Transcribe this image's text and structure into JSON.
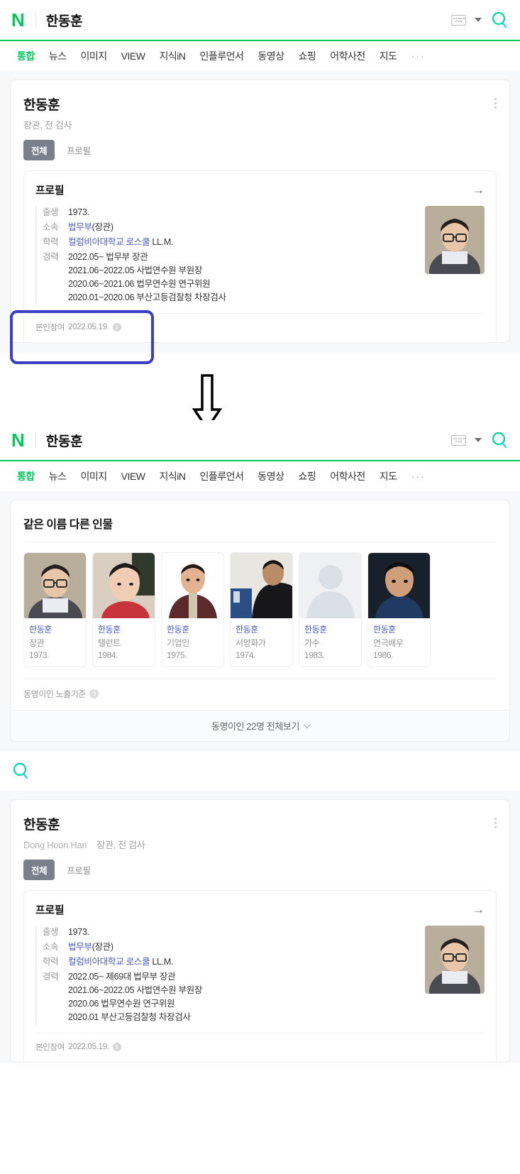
{
  "header": {
    "logo": "N",
    "query": "한동훈",
    "keyboard_icon": "keyboard-icon",
    "caret_icon": "chevron-down-icon",
    "search_icon": "search-icon"
  },
  "tabs": [
    {
      "label": "통합",
      "active": true
    },
    {
      "label": "뉴스",
      "active": false
    },
    {
      "label": "이미지",
      "active": false
    },
    {
      "label": "VIEW",
      "active": false
    },
    {
      "label": "지식iN",
      "active": false
    },
    {
      "label": "인플루언서",
      "active": false
    },
    {
      "label": "동영상",
      "active": false
    },
    {
      "label": "쇼핑",
      "active": false
    },
    {
      "label": "어학사전",
      "active": false
    },
    {
      "label": "지도",
      "active": false
    }
  ],
  "tabs_more": "···",
  "profile_card_top": {
    "name": "한동훈",
    "english_name": "",
    "subtitle": "장관, 전 검사",
    "pills": [
      {
        "label": "전체",
        "active": true
      },
      {
        "label": "프로필",
        "active": false
      }
    ],
    "panel_title": "프로필",
    "arrow": "→",
    "rows": [
      {
        "label": "출생",
        "value": "1973.",
        "link": false
      },
      {
        "label": "소속",
        "value": "법무부",
        "suffix": "(장관)",
        "link": true
      },
      {
        "label": "학력",
        "value": "컬럼비아대학교 로스쿨",
        "suffix": " LL.M.",
        "link": true
      }
    ],
    "career_label": "경력",
    "career": [
      "2022.05~ 법무부 장관",
      "2021.06~2022.05 사법연수원 부원장",
      "2020.06~2021.06 법무연수원 연구위원",
      "2020.01~2020.06 부산고등검찰청 차장검사"
    ],
    "footer_label": "본인참여",
    "footer_date": "2022.05.19.",
    "footer_info_icon": "info-icon"
  },
  "same_name_section": {
    "title": "같은 이름 다른 인물",
    "people": [
      {
        "name": "한동훈",
        "job": "장관",
        "year": "1973.",
        "photo": "minister"
      },
      {
        "name": "한동훈",
        "job": "탤런트",
        "year": "1984.",
        "photo": "talent"
      },
      {
        "name": "한동훈",
        "job": "기업인",
        "year": "1975.",
        "photo": "businessman"
      },
      {
        "name": "한동훈",
        "job": "서양화가",
        "year": "1974.",
        "photo": "painter"
      },
      {
        "name": "한동훈",
        "job": "가수",
        "year": "1983.",
        "photo": "placeholder"
      },
      {
        "name": "한동훈",
        "job": "연극배우",
        "year": "1986.",
        "photo": "actor"
      }
    ],
    "criteria_label": "동명이인 노출기준",
    "criteria_icon": "help-icon",
    "more_label": "동명이인 22명 전체보기",
    "more_icon": "chevron-down-icon"
  },
  "profile_card_bottom": {
    "name": "한동훈",
    "english_name": "Dong Hoon Han",
    "subtitle": "장관, 전 검사",
    "pills": [
      {
        "label": "전체",
        "active": true
      },
      {
        "label": "프로필",
        "active": false
      }
    ],
    "panel_title": "프로필",
    "arrow": "→",
    "rows": [
      {
        "label": "출생",
        "value": "1973.",
        "link": false
      },
      {
        "label": "소속",
        "value": "법무부",
        "suffix": "(장관)",
        "link": true
      },
      {
        "label": "학력",
        "value": "컬럼비아대학교 로스쿨",
        "suffix": " LL.M.",
        "link": true
      }
    ],
    "career_label": "경력",
    "career": [
      "2022.05~ 제69대 법무부 장관",
      "2021.06~2022.05 사법연수원 부원장",
      "2020.06 법무연수원 연구위원",
      "2020.01 부산고등검찰청 차장검사"
    ],
    "footer_label": "본인참여",
    "footer_date": "2022.05.19.",
    "footer_info_icon": "info-icon"
  },
  "annotation": {
    "box_color": "#3b3fc4",
    "arrow_color": "#000000",
    "arrow_icon": "down-arrow-annotation"
  },
  "colors": {
    "brand_green": "#03c75a",
    "link_blue": "#4a5bbf",
    "page_bg": "#f7f8fa",
    "pill_active_bg": "#7a7f8c"
  }
}
